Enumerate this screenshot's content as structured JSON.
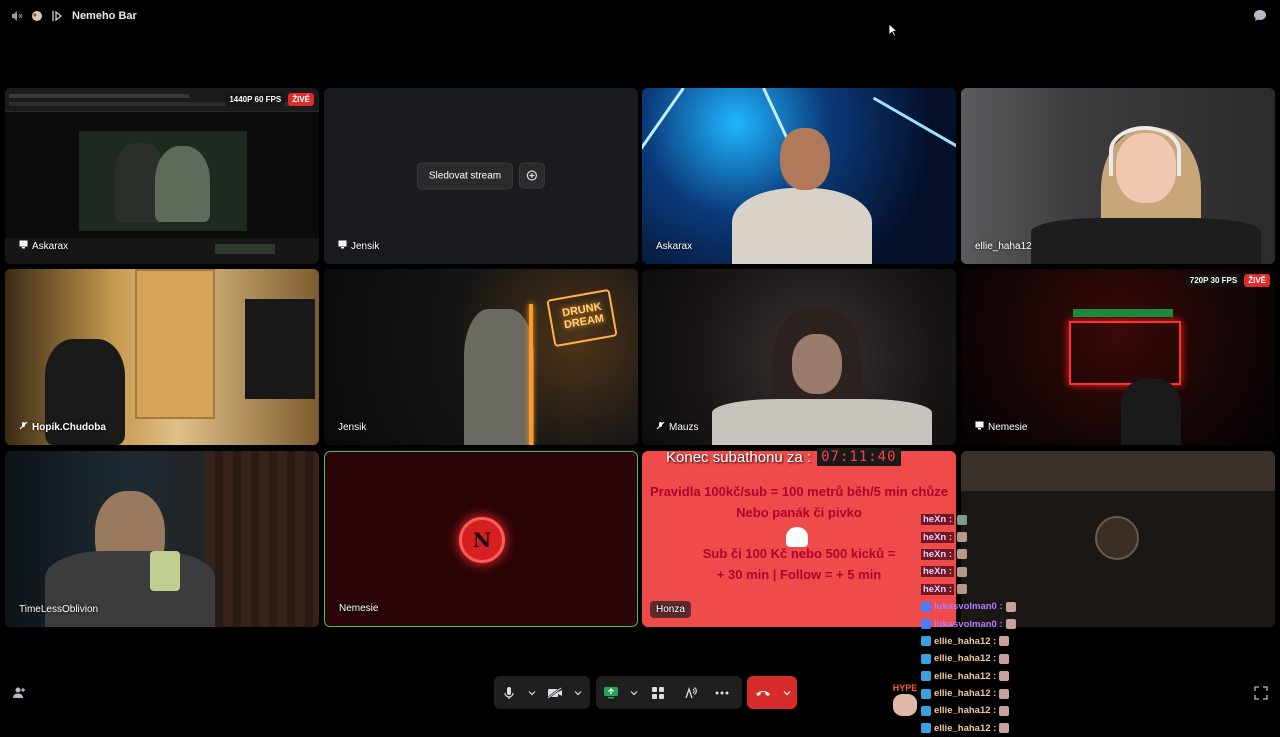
{
  "window": {
    "title": "Nemeho Bar"
  },
  "tiles": [
    {
      "name": "Askarax",
      "badge_quality": "1440P 60 FPS",
      "badge_live": "ŽIVĚ"
    },
    {
      "name": "Jensik",
      "follow_label": "Sledovat stream"
    },
    {
      "name": "Askarax"
    },
    {
      "name": "ellie_haha12"
    },
    {
      "name": "Hopík.Chudoba"
    },
    {
      "name": "Jensik"
    },
    {
      "name": "Mauzs"
    },
    {
      "name": "Nemesie",
      "badge_quality": "720P 30 FPS",
      "badge_live": "ŽIVĚ"
    },
    {
      "name": "TimeLessOblivion"
    },
    {
      "name": "Nemesie"
    },
    {
      "name": "Honza"
    },
    {
      "name": ""
    }
  ],
  "subathon": {
    "label": "Konec subathonu za :",
    "timer": "07:11:40",
    "rules_line1": "Pravidla 100kč/sub = 100 metrů běh/5 min chůze",
    "rules_line2": "Nebo panák či pivko",
    "rules_line3": "Sub či 100 Kč nebo 500 kicků =",
    "rules_line4": "+ 30 min | Follow = + 5 min"
  },
  "neon_sign": "DRUNK DREAM",
  "chat": [
    {
      "user": "heXn :",
      "style": "hexn"
    },
    {
      "user": "heXn :",
      "style": "hexn"
    },
    {
      "user": "heXn :",
      "style": "hexn"
    },
    {
      "user": "heXn :",
      "style": "hexn"
    },
    {
      "user": "heXn :",
      "style": "hexn"
    },
    {
      "user": "lukasvolman0 :",
      "style": "lukas"
    },
    {
      "user": "lukasvolman0 :",
      "style": "lukas"
    },
    {
      "user": "ellie_haha12 :",
      "style": "ellie"
    },
    {
      "user": "ellie_haha12 :",
      "style": "ellie"
    },
    {
      "user": "ellie_haha12 :",
      "style": "ellie"
    },
    {
      "user": "ellie_haha12 :",
      "style": "ellie"
    },
    {
      "user": "ellie_haha12 :",
      "style": "ellie"
    },
    {
      "user": "ellie_haha12 :",
      "style": "ellie"
    }
  ],
  "hype_label": "HYPE",
  "colors": {
    "accent_green": "#2e7d4a",
    "leave_red": "#d62b2b",
    "subathon_bg": "#f04b4b"
  }
}
